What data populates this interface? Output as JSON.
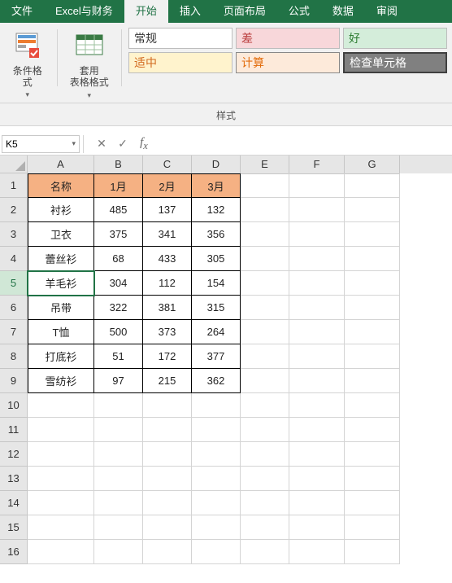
{
  "tabs": {
    "file": "文件",
    "excel_finance": "Excel与财务",
    "home": "开始",
    "insert": "插入",
    "page_layout": "页面布局",
    "formulas": "公式",
    "data": "数据",
    "review": "审阅"
  },
  "ribbon": {
    "cond_format": "条件格式",
    "table_format": "套用\n表格格式",
    "styles": {
      "normal": "常规",
      "bad": "差",
      "good": "好",
      "neutral": "适中",
      "calc": "计算",
      "check_cell": "检查单元格"
    },
    "group_label": "样式"
  },
  "namebox": {
    "value": "K5"
  },
  "formula": {
    "value": ""
  },
  "columns": [
    "A",
    "B",
    "C",
    "D",
    "E",
    "F",
    "G"
  ],
  "rows": [
    "1",
    "2",
    "3",
    "4",
    "5",
    "6",
    "7",
    "8",
    "9",
    "10",
    "11",
    "12",
    "13",
    "14",
    "15",
    "16"
  ],
  "active_cell": {
    "row": 5,
    "col": 1
  },
  "table": {
    "headers": [
      "名称",
      "1月",
      "2月",
      "3月"
    ],
    "rows": [
      [
        "衬衫",
        "485",
        "137",
        "132"
      ],
      [
        "卫衣",
        "375",
        "341",
        "356"
      ],
      [
        "蕾丝衫",
        "68",
        "433",
        "305"
      ],
      [
        "羊毛衫",
        "304",
        "112",
        "154"
      ],
      [
        "吊带",
        "322",
        "381",
        "315"
      ],
      [
        "T恤",
        "500",
        "373",
        "264"
      ],
      [
        "打底衫",
        "51",
        "172",
        "377"
      ],
      [
        "雪纺衫",
        "97",
        "215",
        "362"
      ]
    ]
  }
}
